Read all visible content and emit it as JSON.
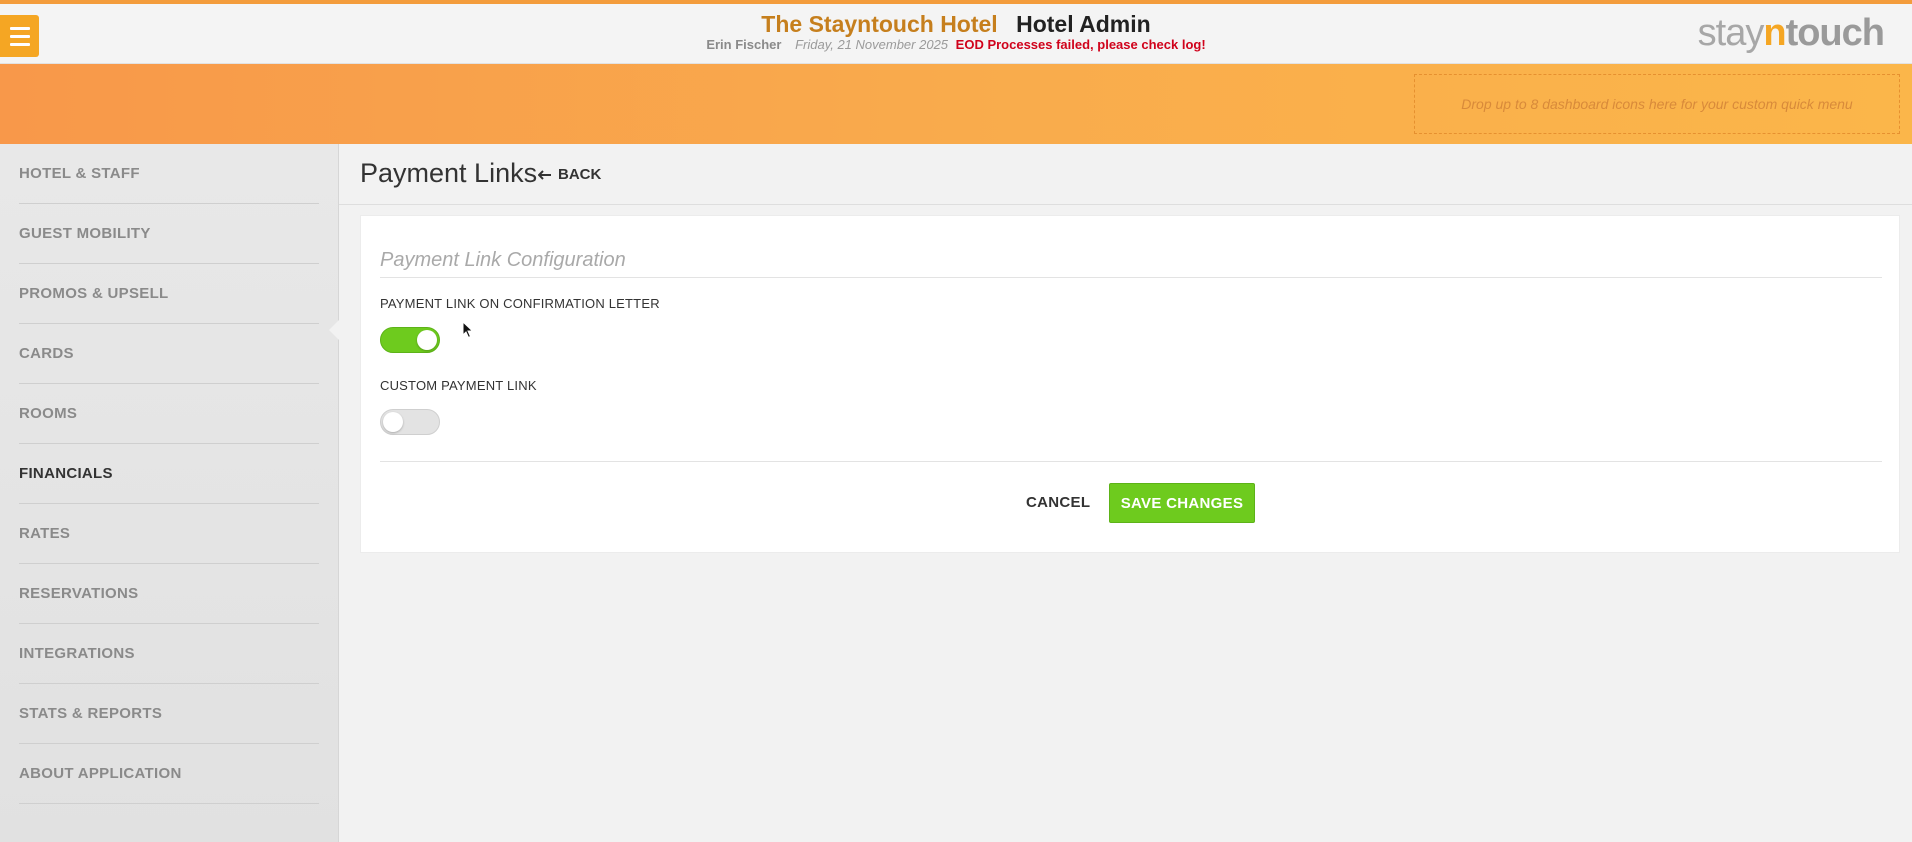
{
  "header": {
    "hotel_name": "The Stayntouch Hotel",
    "admin_name": "Hotel Admin",
    "user": "Erin Fischer",
    "date": "Friday, 21 November 2025",
    "error": "EOD Processes failed, please check log!",
    "brand_prefix": "stay",
    "brand_n": "n",
    "brand_suffix": "touch",
    "menu_icon": "hamburger-icon"
  },
  "quick_menu": {
    "placeholder": "Drop up to 8 dashboard icons here for your custom quick menu"
  },
  "sidebar": {
    "items": [
      {
        "label": "HOTEL & STAFF"
      },
      {
        "label": "GUEST MOBILITY"
      },
      {
        "label": "PROMOS & UPSELL"
      },
      {
        "label": "CARDS"
      },
      {
        "label": "ROOMS"
      },
      {
        "label": "FINANCIALS"
      },
      {
        "label": "RATES"
      },
      {
        "label": "RESERVATIONS"
      },
      {
        "label": "INTEGRATIONS"
      },
      {
        "label": "STATS & REPORTS"
      },
      {
        "label": "ABOUT APPLICATION"
      }
    ],
    "active": "FINANCIALS"
  },
  "main": {
    "title": "Payment Links",
    "back_label": "BACK",
    "back_icon": "arrow-left-icon",
    "section_title": "Payment Link Configuration",
    "fields": [
      {
        "label": "PAYMENT LINK ON CONFIRMATION LETTER",
        "enabled": true
      },
      {
        "label": "CUSTOM PAYMENT LINK",
        "enabled": false
      }
    ],
    "cancel_label": "CANCEL",
    "save_label": "SAVE CHANGES"
  },
  "colors": {
    "accent_orange": "#f5a623",
    "toggle_on": "#6ecb1e",
    "save_green": "#6ecb1e",
    "error_red": "#d0021b"
  }
}
